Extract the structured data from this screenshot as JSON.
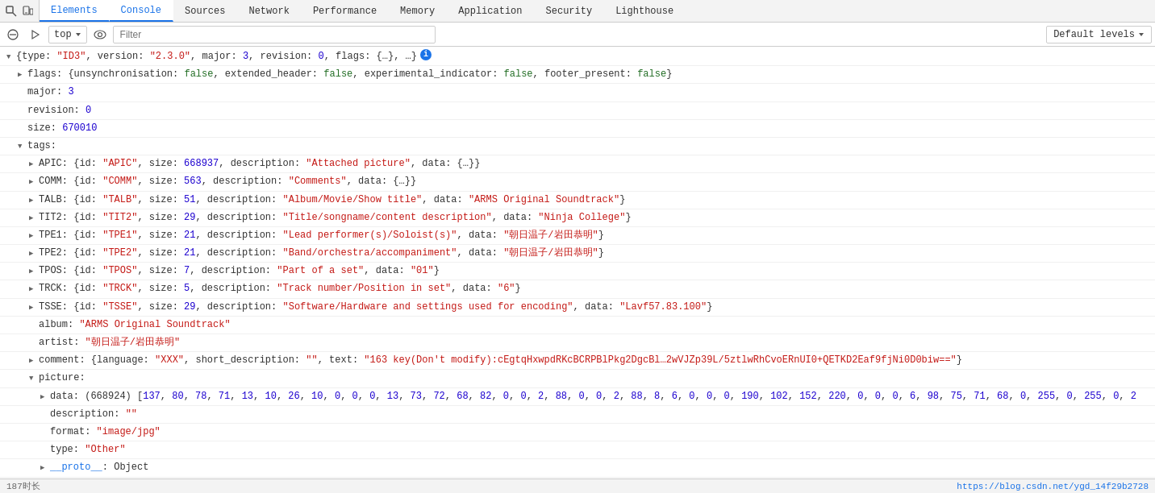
{
  "tabs": [
    {
      "label": "Elements",
      "active": false
    },
    {
      "label": "Console",
      "active": true
    },
    {
      "label": "Sources",
      "active": false
    },
    {
      "label": "Network",
      "active": false
    },
    {
      "label": "Performance",
      "active": false
    },
    {
      "label": "Memory",
      "active": false
    },
    {
      "label": "Application",
      "active": false
    },
    {
      "label": "Security",
      "active": false
    },
    {
      "label": "Lighthouse",
      "active": false
    }
  ],
  "toolbar": {
    "context_value": "top",
    "filter_placeholder": "Filter",
    "levels_label": "Default levels"
  },
  "console": {
    "root_line": "▼ {type: \"ID3\", version: \"2.3.0\", major: 3, revision: 0, flags: {…}, …}",
    "lines": []
  },
  "status_bar": {
    "left": "187时长",
    "right": "https://blog.csdn.net/ygd_14f29b2728"
  }
}
